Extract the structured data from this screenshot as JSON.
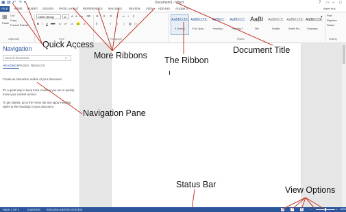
{
  "title_bar": {
    "document_title": "Document1 - Word",
    "help": "?",
    "minimize": "–",
    "restore": "□"
  },
  "tabs": {
    "file": "FILE",
    "items": [
      "HOME",
      "INSERT",
      "DESIGN",
      "PAGE LAYOUT",
      "REFERENCES",
      "MAILINGS",
      "REVIEW",
      "VIEW",
      "ADD-INS",
      "Acrobat XI"
    ],
    "user": "Afeef Huk"
  },
  "ribbon": {
    "clipboard": {
      "paste": "Paste",
      "cut": "Cut",
      "copy": "Copy",
      "format_painter": "Format Painter",
      "label": "Clipboard"
    },
    "font": {
      "font_name": "Calibri (Body)",
      "font_size": "11",
      "label": "Font"
    },
    "paragraph": {
      "label": "Paragraph"
    },
    "styles": {
      "items": [
        {
          "preview": "AaBbCcDc",
          "name": "¶ Normal"
        },
        {
          "preview": "AaBbCcDc",
          "name": "¶ No Spac..."
        },
        {
          "preview": "AaBbCc",
          "name": "Heading 1"
        },
        {
          "preview": "AaBbCcC",
          "name": "Heading 2"
        },
        {
          "preview": "AaBl",
          "name": "Title"
        },
        {
          "preview": "AaBbCcC",
          "name": "Subtitle"
        },
        {
          "preview": "AaBbCcDc",
          "name": "Subtle Em..."
        },
        {
          "preview": "AaBbCcDc",
          "name": "Emphasis"
        }
      ],
      "label": "Styles"
    },
    "editing": {
      "find": "Find",
      "replace": "Replace",
      "select": "Select",
      "label": "Editing"
    }
  },
  "navigation": {
    "title": "Navigation",
    "search_placeholder": "Search document",
    "tabs": [
      "HEADINGS",
      "PAGES",
      "RESULTS"
    ],
    "paragraphs": [
      "Create an interactive outline of your document.",
      "It's a great way to keep track of where you are or quickly move your content around.",
      "To get started, go to the Home tab and apply Heading styles to the headings in your document."
    ]
  },
  "status_bar": {
    "page": "PAGE 1 OF 1",
    "words": "0 WORDS",
    "language": "ENGLISH (UNITED STATES)",
    "zoom": "100%"
  },
  "annotations": {
    "quick_access": "Quick Access",
    "more_ribbons": "More Ribbons",
    "document_title": "Document Title",
    "the_ribbon": "The Ribbon",
    "navigation_pane": "Navigation Pane",
    "status_bar": "Status Bar",
    "view_options": "View Options"
  },
  "colors": {
    "accent": "#2b579a",
    "annotation_line": "#c0392b"
  }
}
